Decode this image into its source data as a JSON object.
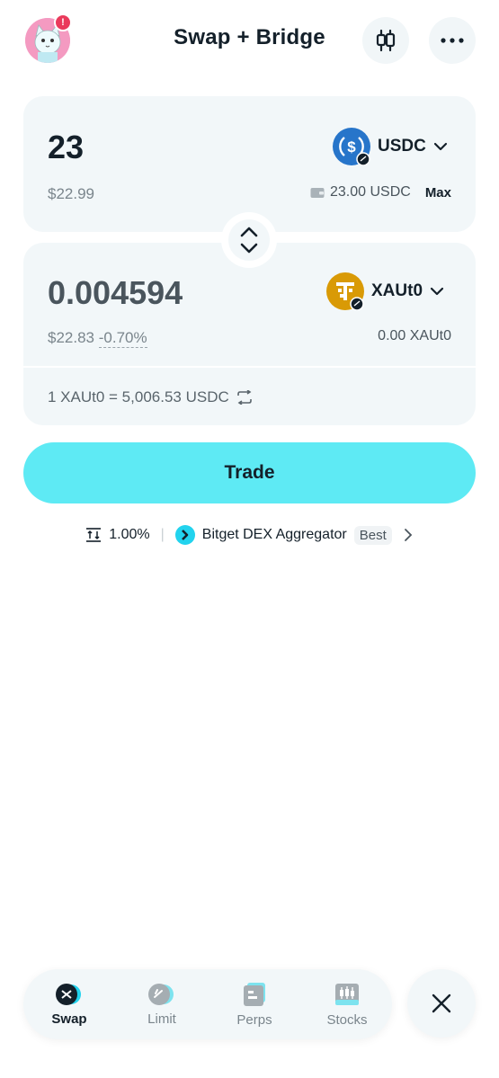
{
  "header": {
    "title": "Swap + Bridge",
    "notification_badge": "!",
    "icons": [
      "avatar",
      "candlestick-chart-icon",
      "more-icon"
    ]
  },
  "from": {
    "amount": "23",
    "usd_value": "$22.99",
    "token": "USDC",
    "balance": "23.00 USDC",
    "max_label": "Max",
    "icon": "usdc-icon"
  },
  "to": {
    "amount": "0.004594",
    "usd_value": "$22.83",
    "price_impact": "-0.70%",
    "token": "XAUt0",
    "balance": "0.00 XAUt0",
    "icon": "xaut0-icon"
  },
  "rate": "1 XAUt0 = 5,006.53 USDC",
  "trade_label": "Trade",
  "route": {
    "slippage": "1.00%",
    "provider": "Bitget DEX Aggregator",
    "badge": "Best"
  },
  "nav": {
    "items": [
      {
        "label": "Swap",
        "icon": "swap-icon",
        "active": true
      },
      {
        "label": "Limit",
        "icon": "limit-icon",
        "active": false
      },
      {
        "label": "Perps",
        "icon": "perps-icon",
        "active": false
      },
      {
        "label": "Stocks",
        "icon": "stocks-icon",
        "active": false
      }
    ]
  },
  "colors": {
    "accent": "#5eeaf4",
    "card_bg": "#f2f7f9",
    "usdc_blue": "#2775ca",
    "xaut_gold": "#d99a06",
    "badge_red": "#ea3a5b"
  }
}
